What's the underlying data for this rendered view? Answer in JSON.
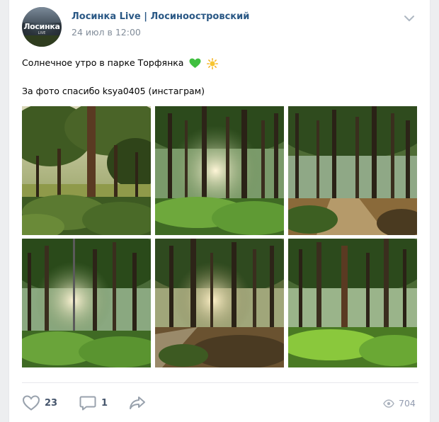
{
  "post": {
    "author": "Лосинка Live | Лосиноостровский",
    "date": "24 июл в 12:00",
    "avatar_text": "Лосинка",
    "avatar_subtext": "LIVE",
    "text_line1": "Солнечное утро в парке Торфянка",
    "text_line2": "За фото спасибо ksya0405 (инстаграм)",
    "emojis": [
      "green-heart-icon",
      "sun-icon"
    ]
  },
  "photos": [
    {
      "label": "park-photo-1"
    },
    {
      "label": "park-photo-2"
    },
    {
      "label": "park-photo-3"
    },
    {
      "label": "park-photo-4"
    },
    {
      "label": "park-photo-5"
    },
    {
      "label": "park-photo-6"
    }
  ],
  "footer": {
    "likes": "23",
    "comments": "1",
    "views": "704"
  },
  "colors": {
    "author_link": "#2a5885",
    "muted": "#818c99",
    "action": "#45556c",
    "background": "#edeef0"
  }
}
